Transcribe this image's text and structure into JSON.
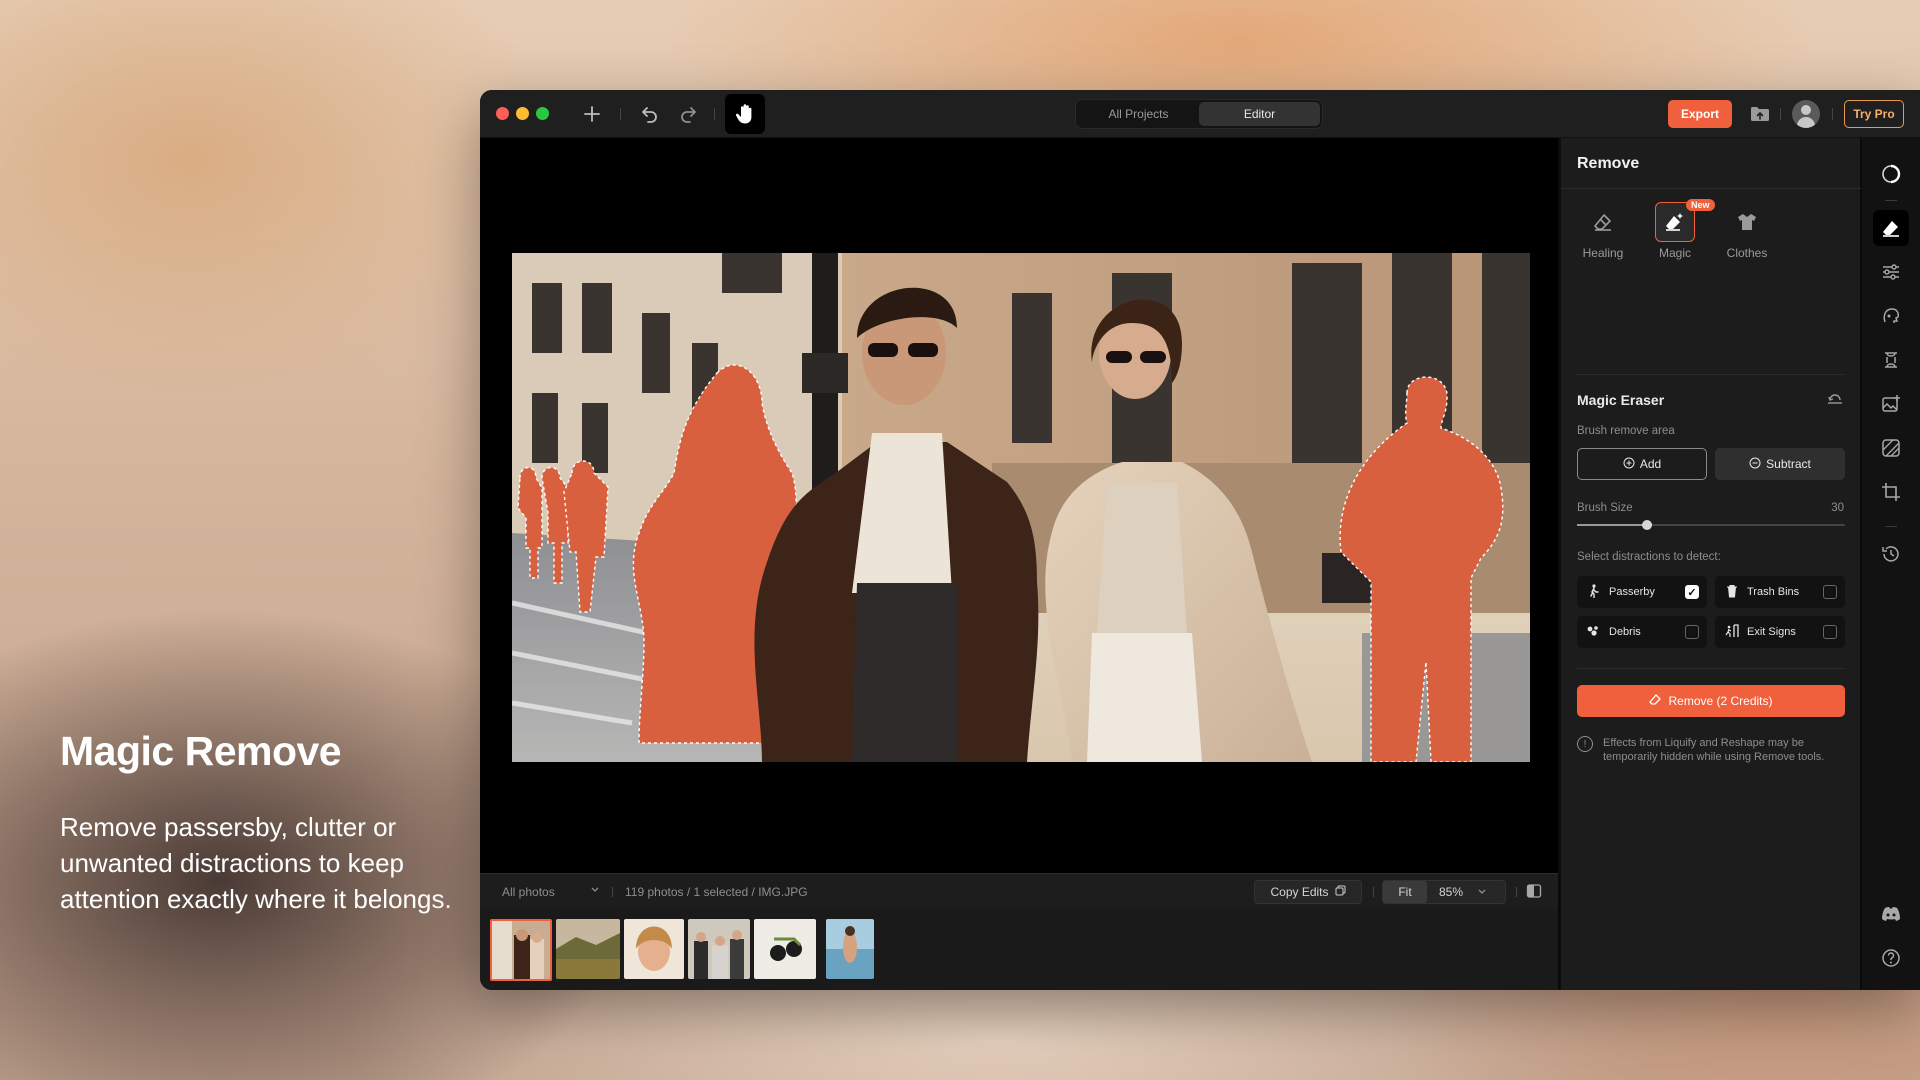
{
  "promo": {
    "title": "Magic Remove",
    "body": "Remove passersby, clutter or unwanted distractions to keep attention exactly where it belongs."
  },
  "titlebar": {
    "tabs": [
      "All Projects",
      "Editor"
    ],
    "active_tab": "Editor",
    "export_label": "Export",
    "try_pro_label": "Try Pro"
  },
  "filmbar": {
    "album": "All photos",
    "info": "119 photos / 1 selected / IMG.JPG",
    "copy_edits": "Copy Edits",
    "fit": "Fit",
    "zoom": "85%"
  },
  "panel": {
    "title": "Remove",
    "tools": [
      {
        "label": "Healing",
        "icon": "eraser-icon"
      },
      {
        "label": "Magic",
        "icon": "magic-eraser-icon",
        "badge": "New"
      },
      {
        "label": "Clothes",
        "icon": "shirt-icon"
      }
    ],
    "section_title": "Magic Eraser",
    "brush_area_label": "Brush remove area",
    "add_label": "Add",
    "subtract_label": "Subtract",
    "brush_size_label": "Brush Size",
    "brush_size_value": "30",
    "brush_size_fraction": 0.26,
    "detect_label": "Select distractions to detect:",
    "distractions": [
      {
        "label": "Passerby",
        "checked": true,
        "icon": "walking-person-icon"
      },
      {
        "label": "Trash Bins",
        "checked": false,
        "icon": "trash-icon"
      },
      {
        "label": "Debris",
        "checked": false,
        "icon": "debris-icon"
      },
      {
        "label": "Exit Signs",
        "checked": false,
        "icon": "exit-sign-icon"
      }
    ],
    "remove_label": "Remove (2 Credits)",
    "note": "Effects from Liquify and Reshape may be temporarily hidden while using Remove tools."
  },
  "colors": {
    "accent": "#f0603c",
    "mask": "#d9603f",
    "pro": "#e79a52"
  }
}
